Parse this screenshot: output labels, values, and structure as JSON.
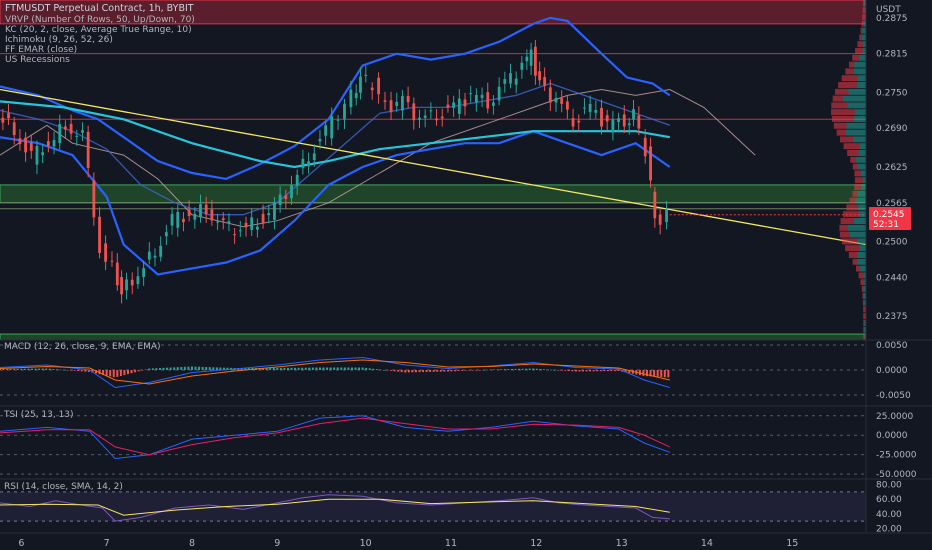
{
  "chart_data": {
    "type": "line",
    "title": "FTMUSDT Perpetual Contract, 1h, BYBIT",
    "indicators": [
      "VRVP (Number Of Rows, 50, Up/Down, 70)",
      "KC (20, 2, close, Average True Range, 10)",
      "Ichimoku (9, 26, 52, 26)",
      "FF EMAR (close)",
      "US Recessions"
    ],
    "currency": "USDT",
    "price_ticks": [
      "0.2875",
      "0.2815",
      "0.2750",
      "0.2690",
      "0.2625",
      "0.2565",
      "0.2500",
      "0.2440",
      "0.2375"
    ],
    "price_range": [
      0.2335,
      0.2905
    ],
    "current_price": "0.2545",
    "countdown": "52:31",
    "time_ticks": [
      "6",
      "7",
      "8",
      "9",
      "10",
      "11",
      "12",
      "13",
      "14",
      "15"
    ],
    "x_range": [
      5.75,
      15.9
    ],
    "last_bar_day": 13.6,
    "price_series": [
      {
        "name": "close",
        "x": [
          5.75,
          5.95,
          6.15,
          6.35,
          6.55,
          6.75,
          6.95,
          7.1,
          7.2,
          7.4,
          7.6,
          7.8,
          8.0,
          8.2,
          8.4,
          8.6,
          8.8,
          9.0,
          9.2,
          9.4,
          9.6,
          9.75,
          9.9,
          10.0,
          10.15,
          10.3,
          10.5,
          10.7,
          10.9,
          11.1,
          11.3,
          11.5,
          11.7,
          11.9,
          12.0,
          12.1,
          12.3,
          12.5,
          12.7,
          12.9,
          13.1,
          13.2,
          13.35,
          13.45,
          13.6
        ],
        "y": [
          0.2715,
          0.2685,
          0.264,
          0.2665,
          0.2695,
          0.2675,
          0.2485,
          0.2455,
          0.2415,
          0.2445,
          0.2485,
          0.2535,
          0.2545,
          0.2555,
          0.2525,
          0.252,
          0.2535,
          0.2555,
          0.2595,
          0.2645,
          0.2685,
          0.2715,
          0.2745,
          0.2775,
          0.2765,
          0.2725,
          0.2735,
          0.2705,
          0.2715,
          0.2725,
          0.2745,
          0.2735,
          0.2765,
          0.2795,
          0.2815,
          0.2765,
          0.2735,
          0.2705,
          0.2725,
          0.2695,
          0.2705,
          0.2715,
          0.2655,
          0.2535,
          0.2545
        ]
      }
    ],
    "keltner_upper": {
      "x": [
        5.75,
        6.2,
        6.6,
        6.9,
        7.2,
        7.6,
        8.0,
        8.4,
        8.8,
        9.2,
        9.6,
        10.0,
        10.4,
        10.8,
        11.2,
        11.6,
        12.0,
        12.2,
        12.4,
        12.8,
        13.1,
        13.4,
        13.6
      ],
      "y": [
        0.276,
        0.2745,
        0.272,
        0.2705,
        0.2675,
        0.2635,
        0.2615,
        0.2605,
        0.263,
        0.266,
        0.2705,
        0.2795,
        0.2815,
        0.2805,
        0.2815,
        0.2835,
        0.2865,
        0.2875,
        0.287,
        0.2815,
        0.2775,
        0.2765,
        0.2745
      ]
    },
    "keltner_middle": {
      "x": [
        5.75,
        6.2,
        6.6,
        7.0,
        7.4,
        7.8,
        8.2,
        8.6,
        9.0,
        9.4,
        9.8,
        10.2,
        10.6,
        11.0,
        11.4,
        11.8,
        12.2,
        12.6,
        13.0,
        13.4,
        13.6
      ],
      "y": [
        0.272,
        0.2705,
        0.2685,
        0.2655,
        0.2595,
        0.2565,
        0.2545,
        0.2545,
        0.2565,
        0.2615,
        0.2665,
        0.2715,
        0.2725,
        0.2725,
        0.2735,
        0.2745,
        0.2765,
        0.2745,
        0.2725,
        0.2705,
        0.2695
      ]
    },
    "keltner_lower": {
      "x": [
        5.75,
        6.2,
        6.6,
        7.0,
        7.2,
        7.6,
        8.0,
        8.4,
        8.8,
        9.2,
        9.6,
        10.0,
        10.4,
        10.8,
        11.2,
        11.6,
        12.0,
        12.4,
        12.8,
        13.2,
        13.6
      ],
      "y": [
        0.2675,
        0.2665,
        0.2645,
        0.2575,
        0.2495,
        0.2445,
        0.2455,
        0.2465,
        0.2485,
        0.2535,
        0.2595,
        0.2625,
        0.2645,
        0.2655,
        0.2665,
        0.2665,
        0.2685,
        0.2665,
        0.2645,
        0.2665,
        0.2625
      ]
    },
    "ema_long": {
      "name": "EMA",
      "x": [
        5.75,
        6.5,
        7.2,
        8.0,
        8.8,
        9.2,
        9.6,
        10.2,
        10.8,
        11.4,
        12.0,
        12.6,
        13.2,
        13.6
      ],
      "y": [
        0.2735,
        0.2725,
        0.2705,
        0.2665,
        0.2635,
        0.2625,
        0.2635,
        0.2655,
        0.2665,
        0.2675,
        0.2685,
        0.2685,
        0.2685,
        0.2675
      ]
    },
    "trendline": {
      "x": [
        5.75,
        15.9
      ],
      "y": [
        0.2755,
        0.2495
      ]
    },
    "ichimoku_span": {
      "x": [
        5.75,
        6.3,
        6.6,
        7.2,
        7.6,
        8.0,
        8.6,
        9.0,
        9.6,
        10.2,
        10.8,
        11.4,
        12.0,
        12.4,
        12.8,
        13.2,
        13.6,
        14.0,
        14.3,
        14.6
      ],
      "y": [
        0.2645,
        0.2695,
        0.2665,
        0.2645,
        0.2605,
        0.2545,
        0.2525,
        0.2535,
        0.2565,
        0.2615,
        0.2665,
        0.2695,
        0.2725,
        0.2745,
        0.2755,
        0.2745,
        0.2755,
        0.2725,
        0.2685,
        0.2645
      ]
    },
    "support_zones": [
      {
        "from": 0.2595,
        "to": 0.2565,
        "color": "#2e7d32"
      },
      {
        "from": 0.2345,
        "to": 0.2335,
        "color": "#2e7d32"
      }
    ],
    "resistance_zone": {
      "from": 0.2905,
      "to": 0.2865,
      "color": "#b2283a"
    },
    "horizontal_levels": [
      "0.2815",
      "0.2705",
      "0.2565",
      "0.2555"
    ],
    "panes": [
      {
        "label": "MACD (12, 26, close, 9, EMA, EMA)",
        "ticks": [
          "0.0050",
          "0.0000",
          "-0.0050"
        ],
        "range": [
          -0.007,
          0.006
        ],
        "macd": {
          "x": [
            5.75,
            6.3,
            6.8,
            7.1,
            7.5,
            8.0,
            8.5,
            9.0,
            9.5,
            10.0,
            10.5,
            11.0,
            11.5,
            12.0,
            12.5,
            13.0,
            13.3,
            13.6
          ],
          "y": [
            0.0005,
            0.001,
            0.0,
            -0.0035,
            -0.0025,
            -0.0005,
            0.0002,
            0.001,
            0.002,
            0.0025,
            0.001,
            0.0003,
            0.0008,
            0.0015,
            0.0005,
            0.0002,
            -0.002,
            -0.0035
          ]
        },
        "signal": {
          "x": [
            5.75,
            6.3,
            6.8,
            7.1,
            7.5,
            8.0,
            8.5,
            9.0,
            9.5,
            10.0,
            10.5,
            11.0,
            11.5,
            12.0,
            12.5,
            13.0,
            13.3,
            13.6
          ],
          "y": [
            0.0003,
            0.0007,
            0.0004,
            -0.002,
            -0.0028,
            -0.0012,
            -0.0002,
            0.0006,
            0.0015,
            0.002,
            0.0015,
            0.0006,
            0.0007,
            0.0012,
            0.0008,
            0.0004,
            -0.0008,
            -0.002
          ]
        }
      },
      {
        "label": "TSI (25, 13, 13)",
        "ticks": [
          "25.0000",
          "0.0000",
          "-25.0000",
          "-50.0000"
        ],
        "range": [
          -55,
          35
        ],
        "tsi": {
          "x": [
            5.75,
            6.3,
            6.8,
            7.1,
            7.5,
            8.0,
            8.5,
            9.0,
            9.5,
            10.0,
            10.5,
            11.0,
            11.5,
            12.0,
            12.5,
            13.0,
            13.3,
            13.6
          ],
          "y": [
            5,
            10,
            5,
            -30,
            -25,
            -5,
            0,
            5,
            22,
            25,
            10,
            5,
            10,
            18,
            12,
            8,
            -10,
            -22
          ]
        },
        "signal": {
          "x": [
            5.75,
            6.3,
            6.8,
            7.1,
            7.5,
            8.0,
            8.5,
            9.0,
            9.5,
            10.0,
            10.5,
            11.0,
            11.5,
            12.0,
            12.5,
            13.0,
            13.3,
            13.6
          ],
          "y": [
            3,
            7,
            7,
            -15,
            -25,
            -12,
            -3,
            3,
            15,
            22,
            15,
            8,
            8,
            14,
            13,
            10,
            0,
            -15
          ]
        }
      },
      {
        "label": "RSI (14, close, SMA, 14, 2)",
        "ticks": [
          "80.00",
          "60.00",
          "40.00",
          "20.00"
        ],
        "range": [
          15,
          85
        ],
        "rsi": {
          "x": [
            5.75,
            6.1,
            6.4,
            6.7,
            6.95,
            7.1,
            7.4,
            7.8,
            8.2,
            8.6,
            9.0,
            9.3,
            9.6,
            10.0,
            10.4,
            10.8,
            11.2,
            11.6,
            12.0,
            12.3,
            12.6,
            12.9,
            13.2,
            13.4,
            13.6
          ],
          "y": [
            55,
            50,
            58,
            52,
            48,
            30,
            35,
            48,
            52,
            46,
            55,
            62,
            66,
            64,
            55,
            52,
            55,
            58,
            62,
            55,
            52,
            50,
            48,
            35,
            33
          ]
        },
        "sma": {
          "x": [
            5.75,
            6.3,
            6.9,
            7.2,
            7.8,
            8.4,
            9.0,
            9.6,
            10.2,
            10.8,
            11.4,
            12.0,
            12.6,
            13.2,
            13.6
          ],
          "y": [
            52,
            53,
            52,
            38,
            45,
            50,
            53,
            60,
            60,
            54,
            56,
            58,
            54,
            50,
            42
          ]
        },
        "band": {
          "upper": 70,
          "lower": 30
        }
      }
    ]
  }
}
